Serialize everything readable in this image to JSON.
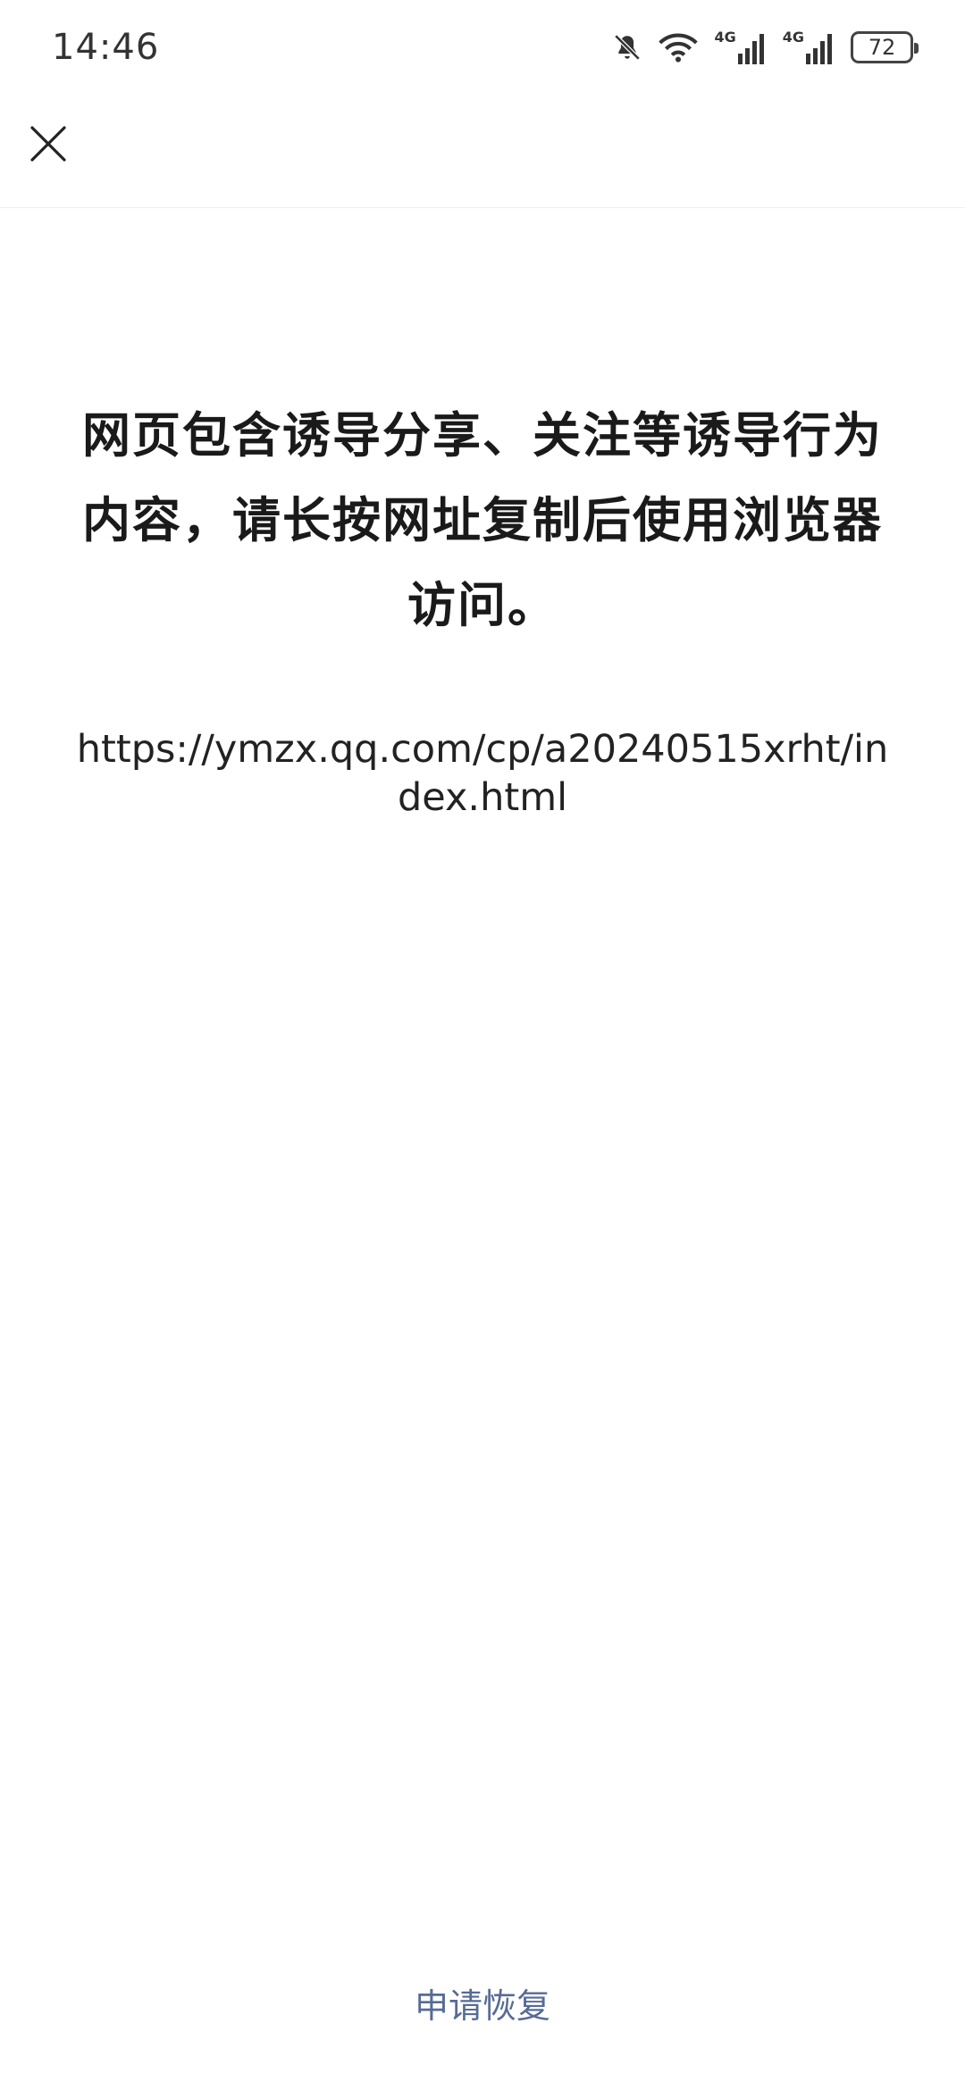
{
  "status_bar": {
    "time": "14:46",
    "network_1": "4G",
    "network_2": "4G",
    "battery": "72",
    "icons": [
      "bell-muted-icon",
      "wifi-icon",
      "signal-icon",
      "signal-icon",
      "battery-icon"
    ]
  },
  "top_bar": {
    "close_icon": "close-icon"
  },
  "main": {
    "message": "网页包含诱导分享、关注等诱导行为内容，请长按网址复制后使用浏览器访问。",
    "url": "https://ymzx.qq.com/cp/a20240515xrht/index.html"
  },
  "footer": {
    "restore_label": "申请恢复"
  },
  "colors": {
    "link": "#576b95",
    "text": "#1a1a1a",
    "background": "#ffffff"
  }
}
